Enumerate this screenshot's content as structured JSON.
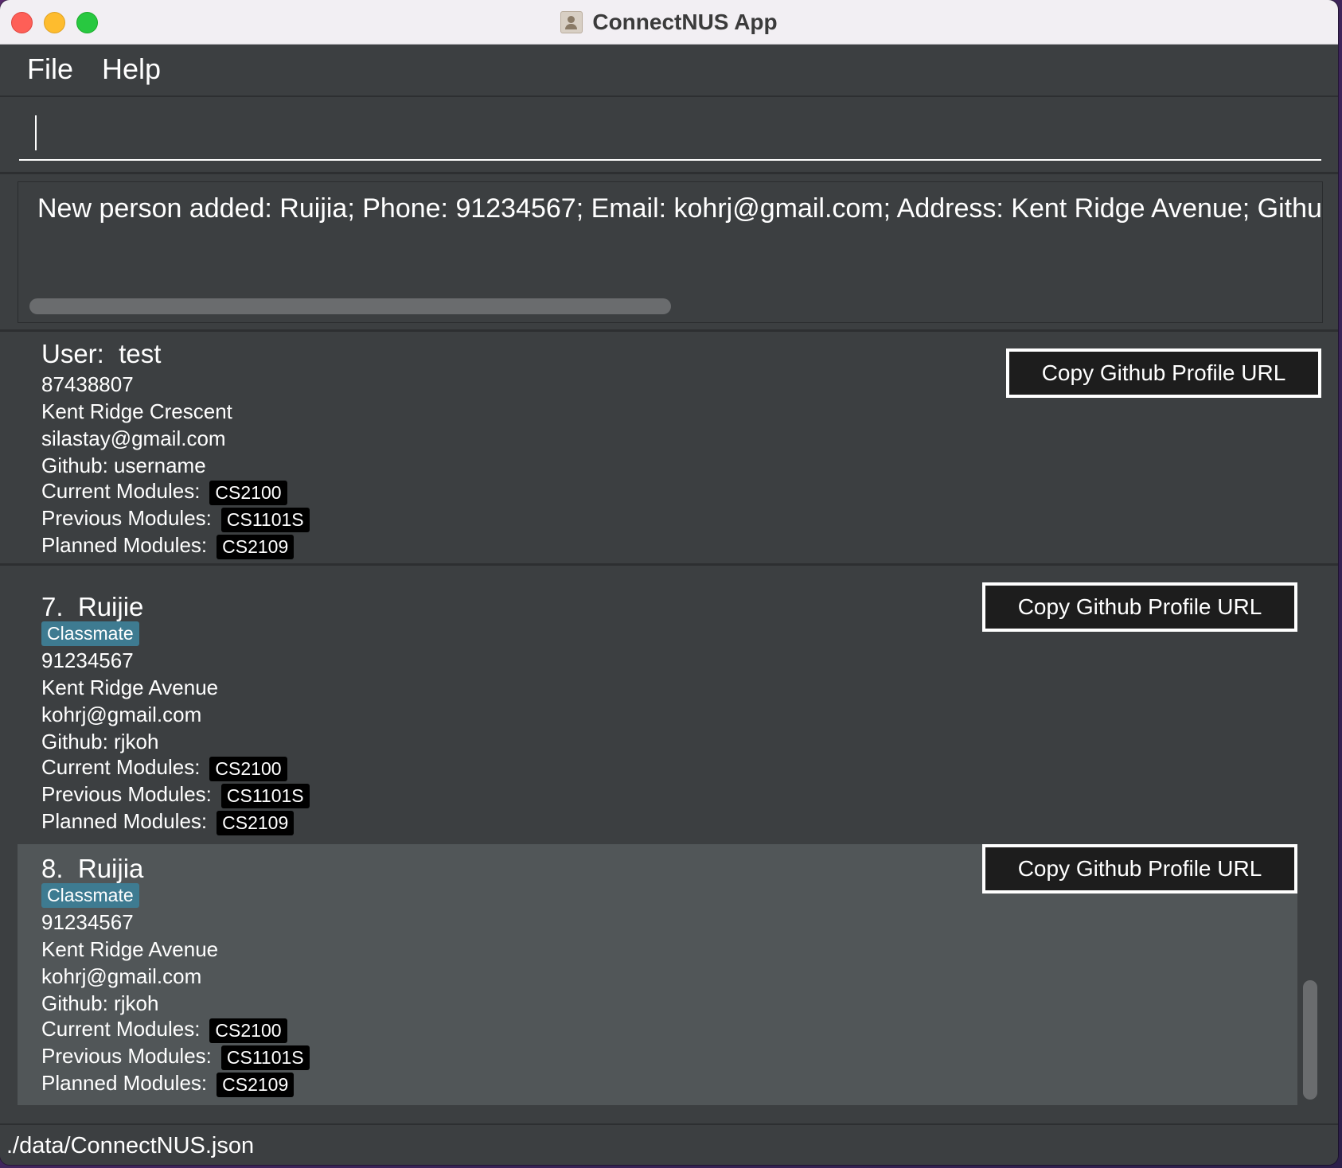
{
  "window": {
    "title": "ConnectNUS App"
  },
  "menu": {
    "file": "File",
    "help": "Help"
  },
  "command": {
    "value": ""
  },
  "result": {
    "text": "New person added: Ruijia; Phone: 91234567; Email: kohrj@gmail.com; Address: Kent Ridge Avenue; Github: rjko"
  },
  "user": {
    "title_prefix": "User:",
    "name": "test",
    "phone": "87438807",
    "address": "Kent Ridge Crescent",
    "email": "silastay@gmail.com",
    "github": "Github: username",
    "current_label": "Current Modules:",
    "current": "CS2100",
    "previous_label": "Previous Modules:",
    "previous": "CS1101S",
    "planned_label": "Planned Modules:",
    "planned": "CS2109",
    "copy_label": "Copy Github Profile URL"
  },
  "persons": [
    {
      "index": "7.",
      "name": "Ruijie",
      "tag": "Classmate",
      "phone": "91234567",
      "address": "Kent Ridge Avenue",
      "email": "kohrj@gmail.com",
      "github": "Github: rjkoh",
      "current_label": "Current Modules:",
      "current": "CS2100",
      "previous_label": "Previous Modules:",
      "previous": "CS1101S",
      "planned_label": "Planned Modules:",
      "planned": "CS2109",
      "copy_label": "Copy Github Profile URL"
    },
    {
      "index": "8.",
      "name": "Ruijia",
      "tag": "Classmate",
      "phone": "91234567",
      "address": "Kent Ridge Avenue",
      "email": "kohrj@gmail.com",
      "github": "Github: rjkoh",
      "current_label": "Current Modules:",
      "current": "CS2100",
      "previous_label": "Previous Modules:",
      "previous": "CS1101S",
      "planned_label": "Planned Modules:",
      "planned": "CS2109",
      "copy_label": "Copy Github Profile URL"
    }
  ],
  "status": {
    "path": "./data/ConnectNUS.json"
  }
}
